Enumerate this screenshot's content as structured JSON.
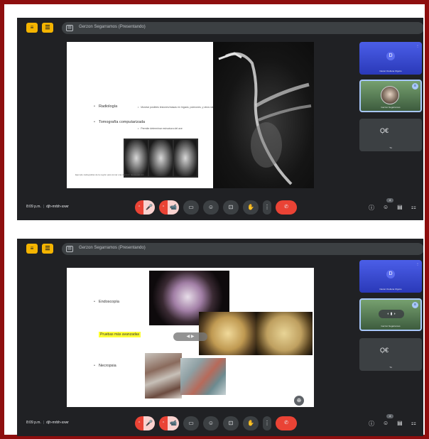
{
  "panels": [
    {
      "meeting_title": "Gerzon Segarramos (Presentando)",
      "sidebar": {
        "btn_a": "≡",
        "btn_b": "☰",
        "doc": "▤"
      },
      "slide": {
        "bullets": [
          "Radiología",
          "Tomografía computarizada"
        ],
        "subs": [
          "Mostrar posibles lesiones/masas en hígado, pulmones, y otros sistemas",
          "Permite determinar estructura del ave"
        ],
        "caption": "Ejemplo radiografías de la región para tomar una decisión dentro del ave"
      },
      "tiles": {
        "blue": {
          "initial": "D",
          "name": "Daniel Orellana Olgutio"
        },
        "cam": {
          "name": "Gerzon Segarramos"
        },
        "grey": {
          "name": "Tú",
          "glyph": "Ọ€"
        }
      },
      "bottom": {
        "time": "8:09 p.m.",
        "code": "djh-mrbh-sxwr",
        "participants": "4"
      }
    },
    {
      "meeting_title": "Gerzon Segarramos (Presentando)",
      "sidebar": {
        "btn_a": "≡",
        "btn_b": "☰",
        "doc": "▤"
      },
      "slide": {
        "bullets": [
          "Endoscopía",
          "Necropsia"
        ],
        "highlight": "Pruebas más avanzadas",
        "toggle": "◀ ▶"
      },
      "tiles": {
        "blue": {
          "initial": "D",
          "name": "Daniel Orellana Olgutio"
        },
        "cam": {
          "name": "Gerzon Segarramos",
          "faces": "◐ ▮ ◑"
        },
        "grey": {
          "name": "Tú",
          "glyph": "Ọ€"
        }
      },
      "bottom": {
        "time": "8:09 p.m.",
        "code": "djh-mrbh-sxwr",
        "participants": "4"
      }
    }
  ],
  "icons": {
    "mic": "🎤",
    "cam": "📹",
    "cc": "▭",
    "emoji": "☺",
    "present": "⊡",
    "hand": "✋",
    "more": "⋮",
    "end": "✆",
    "info": "ⓘ",
    "people": "☺",
    "chat": "▤",
    "activities": "⚏"
  },
  "colors": {
    "frame": "#8e0e0e",
    "meet_bg": "#202124",
    "accent_yellow": "#f4b400",
    "end_red": "#ea4335"
  }
}
